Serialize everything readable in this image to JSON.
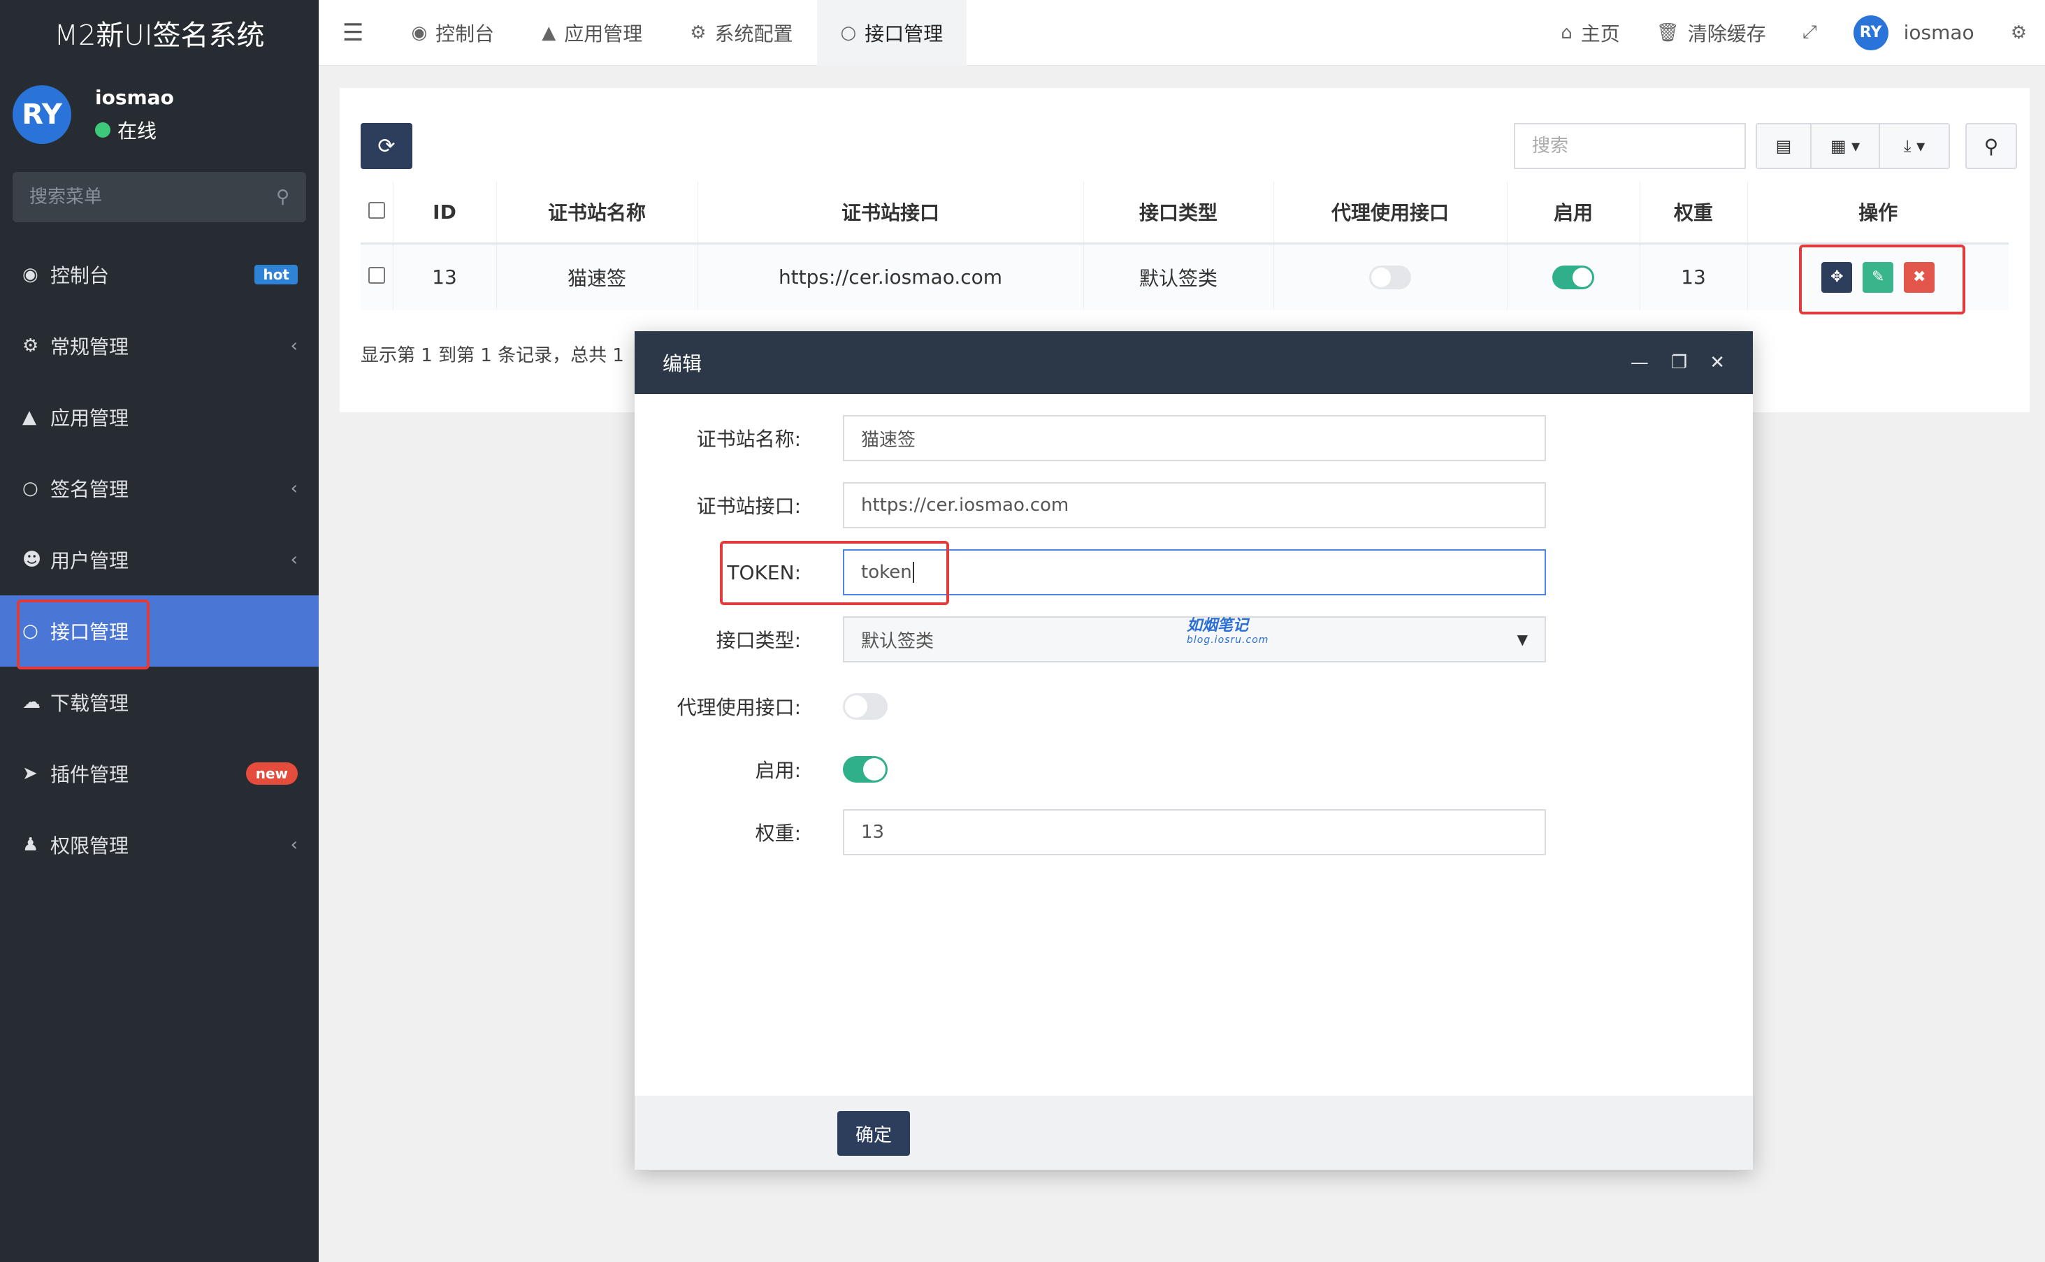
{
  "app": {
    "title": "M2新UI签名系统"
  },
  "user": {
    "name": "iosmao",
    "status": "在线",
    "avatar_text": "RY"
  },
  "sidebar": {
    "search_placeholder": "搜索菜单",
    "items": [
      {
        "label": "控制台",
        "icon": "dashboard-icon",
        "badge": "hot"
      },
      {
        "label": "常规管理",
        "icon": "cogs-icon",
        "chevron": "‹"
      },
      {
        "label": "应用管理",
        "icon": "app-icon"
      },
      {
        "label": "签名管理",
        "icon": "circle-icon",
        "chevron": "‹"
      },
      {
        "label": "用户管理",
        "icon": "user-icon",
        "chevron": "‹"
      },
      {
        "label": "接口管理",
        "icon": "circle-icon",
        "active": true
      },
      {
        "label": "下载管理",
        "icon": "cloud-download-icon"
      },
      {
        "label": "插件管理",
        "icon": "rocket-icon",
        "badge": "new"
      },
      {
        "label": "权限管理",
        "icon": "users-icon",
        "chevron": "‹"
      }
    ]
  },
  "topnav": {
    "tabs": [
      {
        "label": "控制台",
        "icon": "dashboard-icon"
      },
      {
        "label": "应用管理",
        "icon": "app-icon"
      },
      {
        "label": "系统配置",
        "icon": "gear-icon"
      },
      {
        "label": "接口管理",
        "icon": "circle-icon",
        "active": true
      }
    ],
    "home": "主页",
    "clear_cache": "清除缓存",
    "username": "iosmao"
  },
  "toolbar": {
    "search_placeholder": "搜索"
  },
  "table": {
    "headers": [
      "ID",
      "证书站名称",
      "证书站接口",
      "接口类型",
      "代理使用接口",
      "启用",
      "权重",
      "操作"
    ],
    "rows": [
      {
        "id": "13",
        "name": "猫速签",
        "url": "https://cer.iosmao.com",
        "type": "默认签类",
        "proxy": false,
        "enabled": true,
        "weight": "13"
      }
    ]
  },
  "records_text": "显示第 1 到第 1 条记录，总共 1",
  "modal": {
    "title": "编辑",
    "fields": {
      "name_label": "证书站名称:",
      "name_value": "猫速签",
      "url_label": "证书站接口:",
      "url_value": "https://cer.iosmao.com",
      "token_label": "TOKEN:",
      "token_value": "token",
      "type_label": "接口类型:",
      "type_value": "默认签类",
      "proxy_label": "代理使用接口:",
      "enabled_label": "启用:",
      "weight_label": "权重:",
      "weight_value": "13"
    },
    "watermark": {
      "title": "如烟笔记",
      "sub": "blog.iosru.com"
    },
    "confirm": "确定"
  },
  "colors": {
    "sidebar_bg": "#262c32",
    "active": "#4a76d5",
    "primary": "#2c3e5c",
    "success": "#38b58a",
    "danger": "#e2564b",
    "highlight": "#e23b3b"
  }
}
